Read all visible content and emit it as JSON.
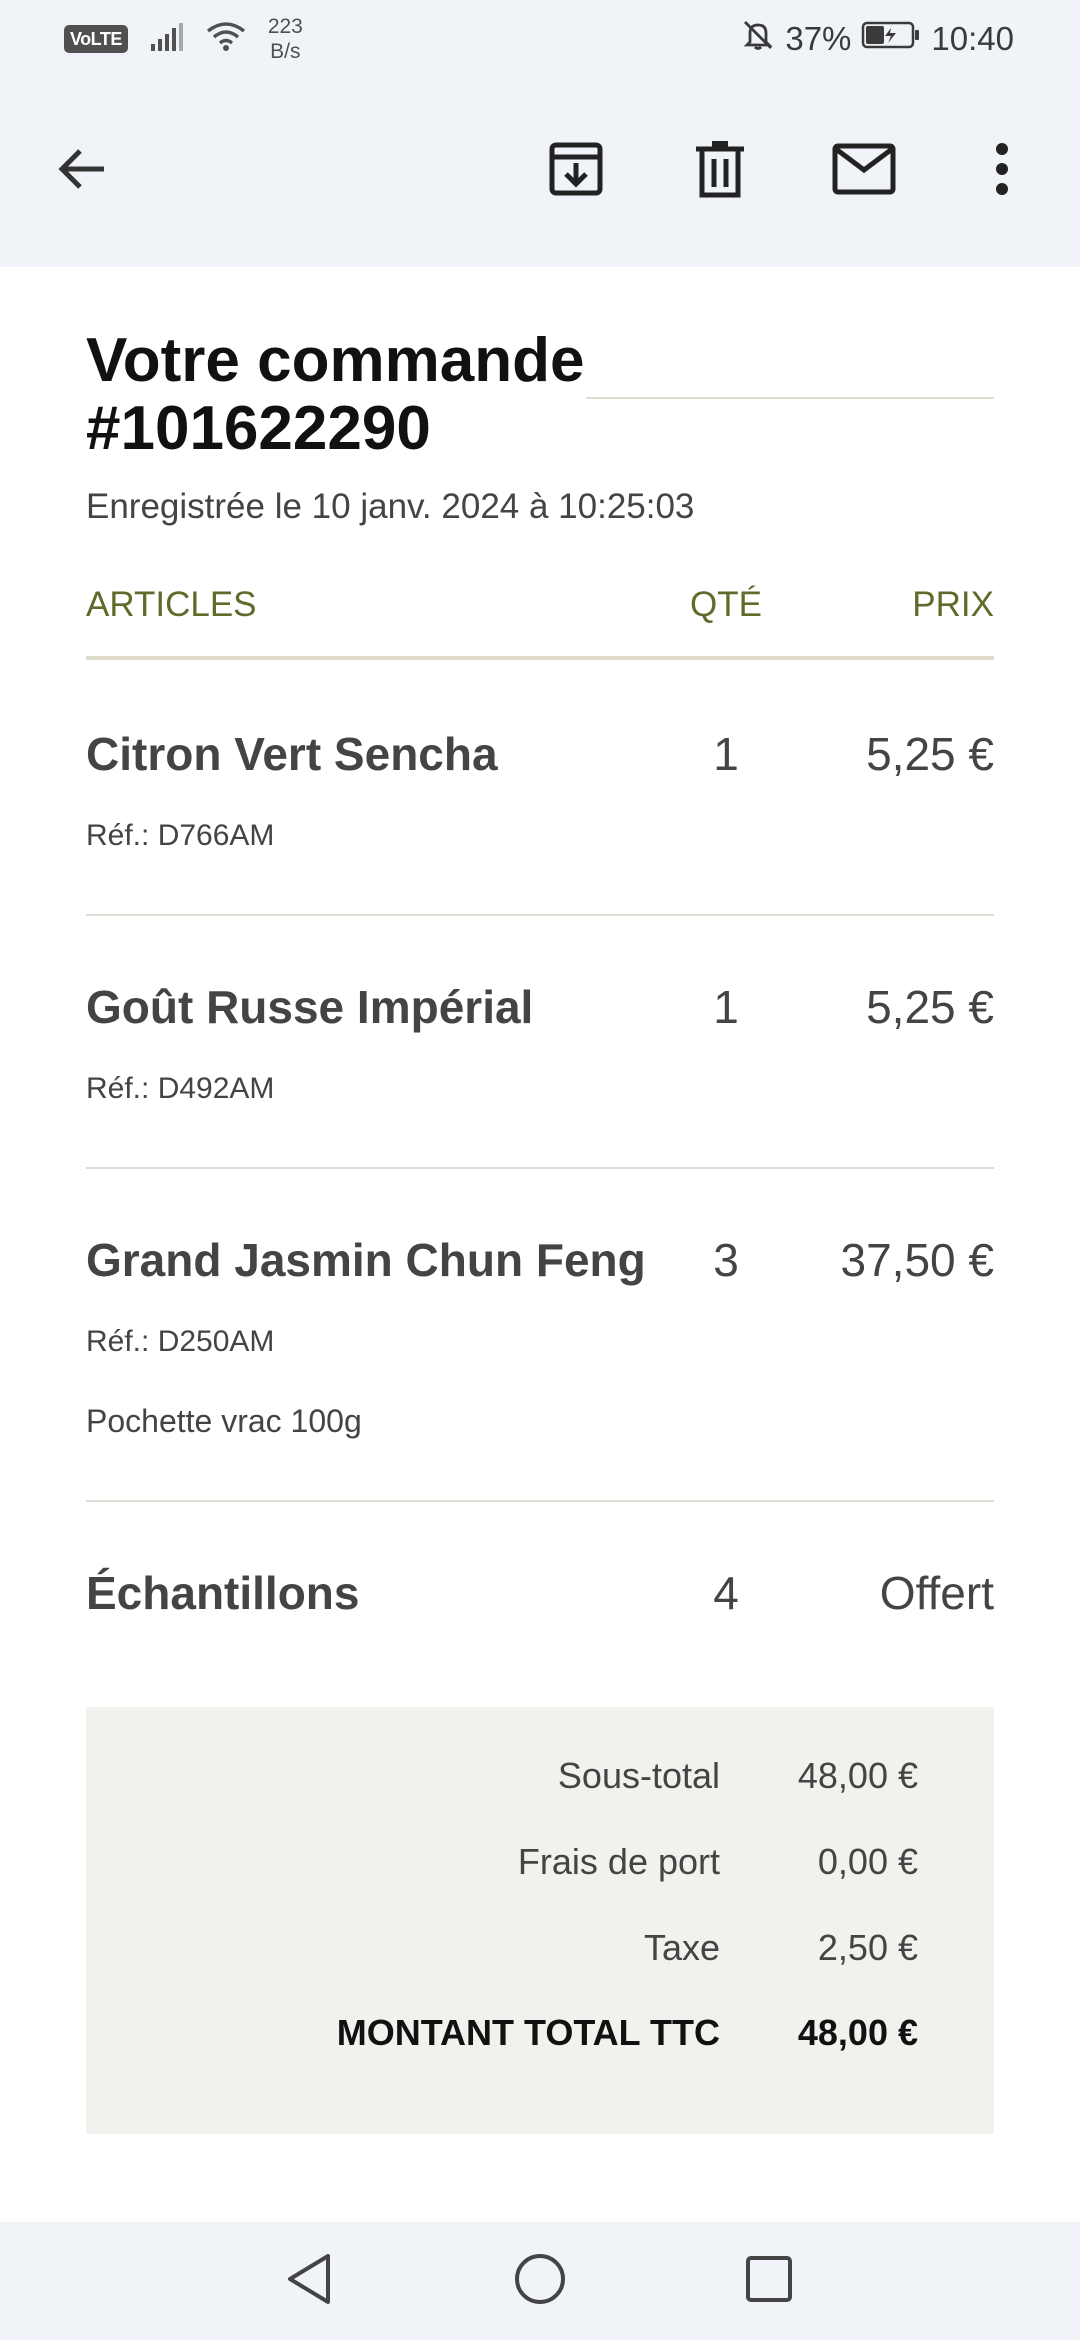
{
  "status_bar": {
    "volte": "VoLTE",
    "net_speed_value": "223",
    "net_speed_unit": "B/s",
    "battery": "37%",
    "time": "10:40",
    "icons": [
      "signal-icon",
      "wifi-icon",
      "mute-icon",
      "battery-icon"
    ]
  },
  "toolbar": {
    "icons": [
      "back-arrow-icon",
      "archive-icon",
      "trash-icon",
      "mail-icon",
      "more-vertical-icon"
    ]
  },
  "order": {
    "title_line1": "Votre commande",
    "title_line2": "#101622290",
    "registered": "Enregistrée le 10 janv. 2024 à 10:25:03",
    "headers": {
      "articles": "ARTICLES",
      "qty": "QTÉ",
      "price": "PRIX"
    },
    "items": [
      {
        "name": "Citron Vert Sencha",
        "qty": "1",
        "price": "5,25 €",
        "ref": "Réf.: D766AM"
      },
      {
        "name": "Goût Russe Impérial",
        "qty": "1",
        "price": "5,25 €",
        "ref": "Réf.: D492AM"
      },
      {
        "name": "Grand Jasmin Chun Feng",
        "qty": "3",
        "price": "37,50 €",
        "ref": "Réf.: D250AM",
        "variant": "Pochette vrac 100g"
      },
      {
        "name": "Échantillons",
        "qty": "4",
        "price": "Offert"
      }
    ],
    "totals": {
      "subtotal_label": "Sous-total",
      "subtotal_value": "48,00 €",
      "shipping_label": "Frais de port",
      "shipping_value": "0,00 €",
      "tax_label": "Taxe",
      "tax_value": "2,50 €",
      "grand_label": "MONTANT TOTAL TTC",
      "grand_value": "48,00 €"
    }
  },
  "nav_bar": {
    "icons": [
      "nav-back-icon",
      "nav-home-icon",
      "nav-recents-icon"
    ]
  },
  "colors": {
    "bar_background": "#f0f4f9",
    "header_text": "#5f6b2a",
    "totals_background": "#eff2ed"
  }
}
